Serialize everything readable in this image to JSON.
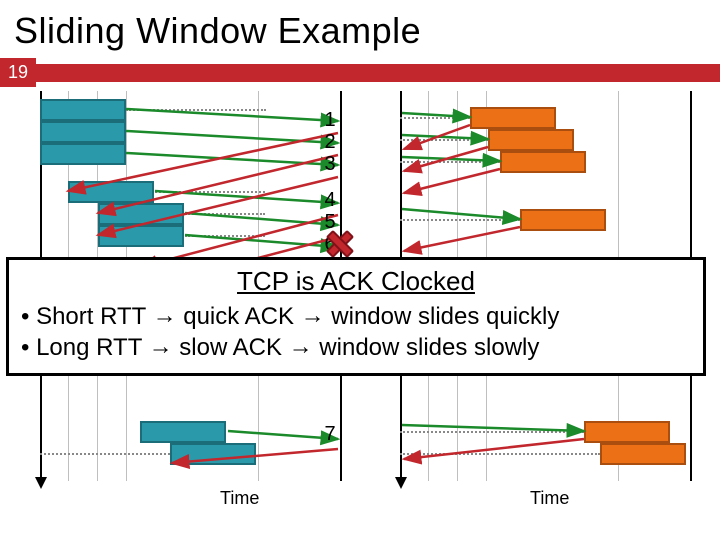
{
  "title": "Sliding Window Example",
  "slide_number": "19",
  "axis_label_left": "Time",
  "axis_label_right": "Time",
  "sequence_numbers": [
    "1",
    "2",
    "3",
    "4",
    "5",
    "6",
    "7"
  ],
  "dropped_packet": "6",
  "callout": {
    "heading": "TCP is ACK Clocked",
    "bullet1_a": "Short RTT ",
    "bullet1_b": " quick ACK ",
    "bullet1_c": " window slides quickly",
    "bullet2_a": "Long RTT ",
    "bullet2_b": " slow ACK ",
    "bullet2_c": " window slides slowly"
  },
  "arrow_glyph": "→",
  "colors": {
    "accent_red": "#c1272d",
    "sender_teal": "#2a9aab",
    "receiver_orange": "#ec7016",
    "data_arrow": "#1b8a2a",
    "ack_arrow": "#c1272d"
  },
  "chart_data": {
    "type": "sequence-diagram",
    "panels": [
      {
        "side": "left",
        "role": "sender-timeline",
        "blocks": [
          1,
          2,
          3,
          4,
          5,
          6,
          7,
          8
        ],
        "dashed_time_markers": [
          1,
          4,
          5,
          6,
          8
        ]
      },
      {
        "side": "right",
        "role": "receiver-timeline",
        "blocks": [
          1,
          2,
          3,
          4,
          7,
          8
        ],
        "dashed_time_markers": [
          1,
          2,
          3,
          4,
          7,
          8
        ]
      }
    ],
    "events": [
      {
        "seq": 1,
        "data": true,
        "ack": true
      },
      {
        "seq": 2,
        "data": true,
        "ack": true
      },
      {
        "seq": 3,
        "data": true,
        "ack": true
      },
      {
        "seq": 4,
        "data": true,
        "ack": true
      },
      {
        "seq": 5,
        "data": true,
        "ack": true
      },
      {
        "seq": 6,
        "data": true,
        "ack": false,
        "dropped": true
      },
      {
        "seq": 7,
        "data": true,
        "ack": true
      }
    ],
    "annotation": "Packet 6 is lost (red cross). Callout explains ACK clocking behavior relative to RTT."
  }
}
